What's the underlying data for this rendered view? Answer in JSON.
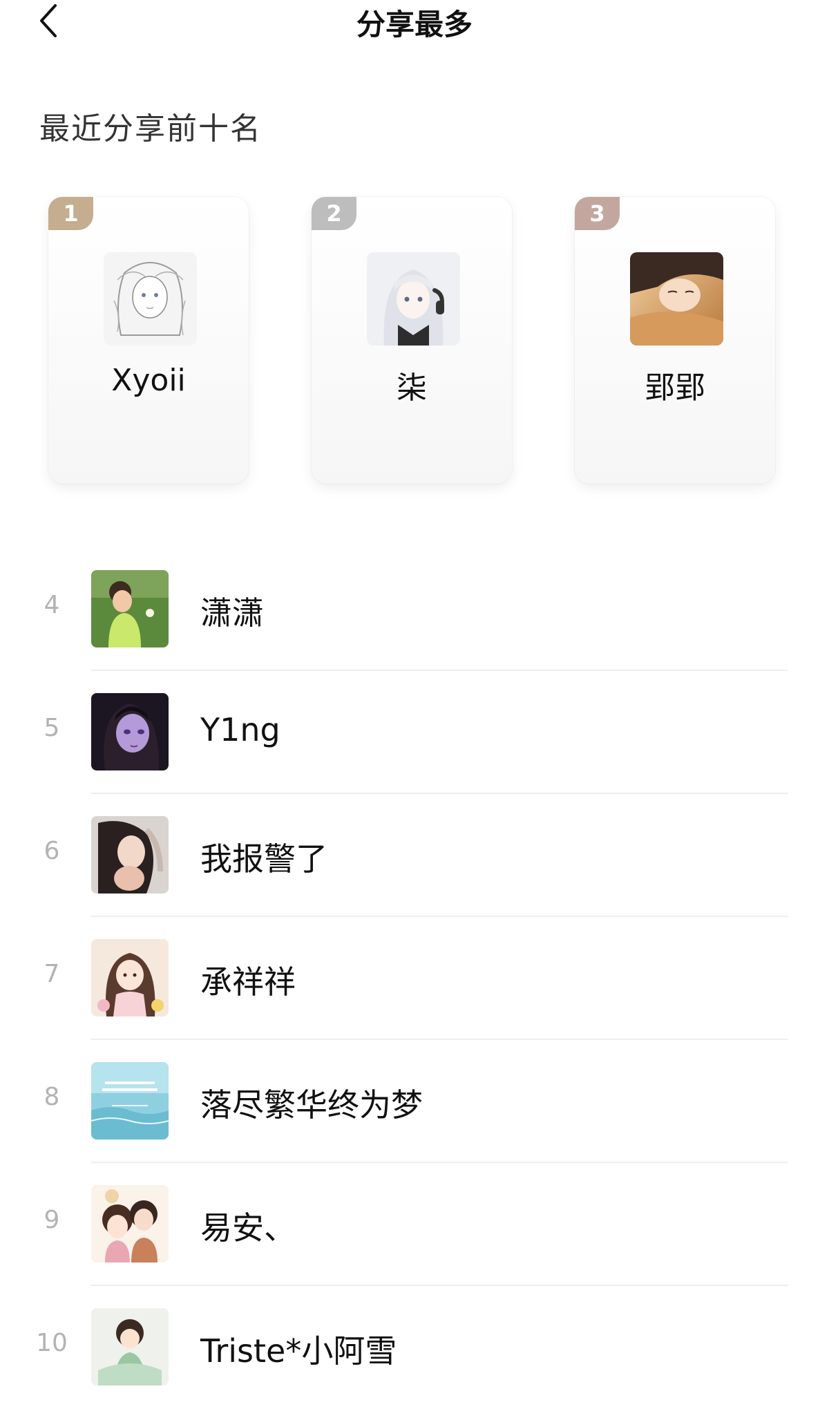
{
  "header": {
    "title": "分享最多",
    "back_icon": "chevron-left-icon"
  },
  "section": {
    "title": "最近分享前十名"
  },
  "podium": [
    {
      "rank": "1",
      "name": "Xyoii",
      "badge_color": "#c5ae8f"
    },
    {
      "rank": "2",
      "name": "柒",
      "badge_color": "#bdbdbd"
    },
    {
      "rank": "3",
      "name": "郢郢",
      "badge_color": "#c3a79f"
    }
  ],
  "list": [
    {
      "rank": "4",
      "name": "潇潇"
    },
    {
      "rank": "5",
      "name": "Y1ng"
    },
    {
      "rank": "6",
      "name": "我报警了"
    },
    {
      "rank": "7",
      "name": "承祥祥"
    },
    {
      "rank": "8",
      "name": "落尽繁华终为梦"
    },
    {
      "rank": "9",
      "name": "易安、"
    },
    {
      "rank": "10",
      "name": "Triste*小阿雪"
    }
  ]
}
